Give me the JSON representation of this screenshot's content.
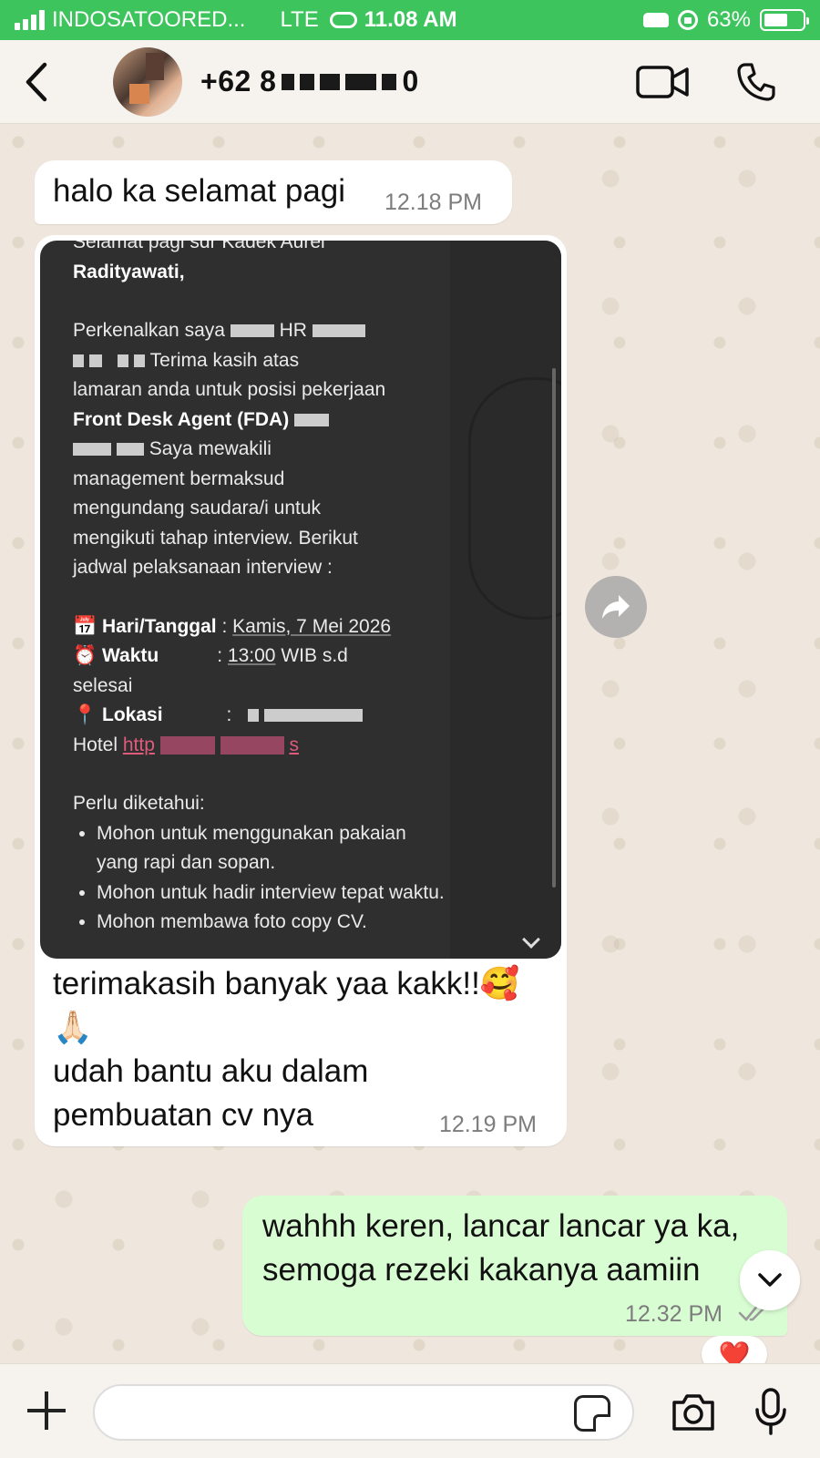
{
  "status_bar": {
    "carrier": "INDOSATOORED...",
    "network": "LTE",
    "time": "11.08 AM",
    "battery": "63%",
    "battery_level": 0.63
  },
  "header": {
    "contact_name": "+62 8",
    "contact_name_suffix": "0",
    "back_icon": "chevron-left-icon",
    "video_icon": "video-camera-icon",
    "call_icon": "phone-icon"
  },
  "messages": [
    {
      "direction": "in",
      "text": "halo ka selamat pagi",
      "time": "12.18 PM"
    },
    {
      "direction": "in",
      "media": {
        "lines": [
          "Selamat pagi sdr Kadek Aurel",
          "Radityawati,",
          "Perkenalkan saya",
          "HR",
          "Terima kasih atas",
          "lamaran anda untuk posisi pekerjaan",
          "Front Desk Agent (FDA)",
          "Saya mewakili",
          "management bermaksud",
          "mengundang saudara/i untuk",
          "mengikuti tahap interview. Berikut",
          "jadwal pelaksanaan interview :",
          "📅",
          "Hari/Tanggal",
          ":",
          "Kamis, 7 Mei 2026",
          "⏰",
          "Waktu",
          ":",
          "13:00",
          "WIB s.d",
          "selesai",
          "📍",
          "Lokasi",
          ":",
          "Hotel",
          "http",
          "s",
          "Perlu diketahui:",
          "Mohon untuk menggunakan pakaian yang rapi dan sopan.",
          "Mohon untuk hadir interview tepat waktu.",
          "Mohon membawa foto copy CV."
        ]
      },
      "caption_line1": "terimakasih banyak yaa kakk!!🥰",
      "caption_line2": "🙏🏻",
      "caption_line3": "udah bantu aku dalam",
      "caption_line4": "pembuatan cv nya",
      "time": "12.19 PM"
    },
    {
      "direction": "out",
      "line1": "wahhh keren, lancar lancar ya ka,",
      "line2": "semoga rezeki kakanya aamiin",
      "time": "12.32 PM",
      "reaction": "❤️"
    }
  ],
  "composer": {
    "placeholder": "",
    "plus_icon": "plus-icon",
    "sticker_icon": "sticker-icon",
    "camera_icon": "camera-icon",
    "mic_icon": "microphone-icon"
  }
}
